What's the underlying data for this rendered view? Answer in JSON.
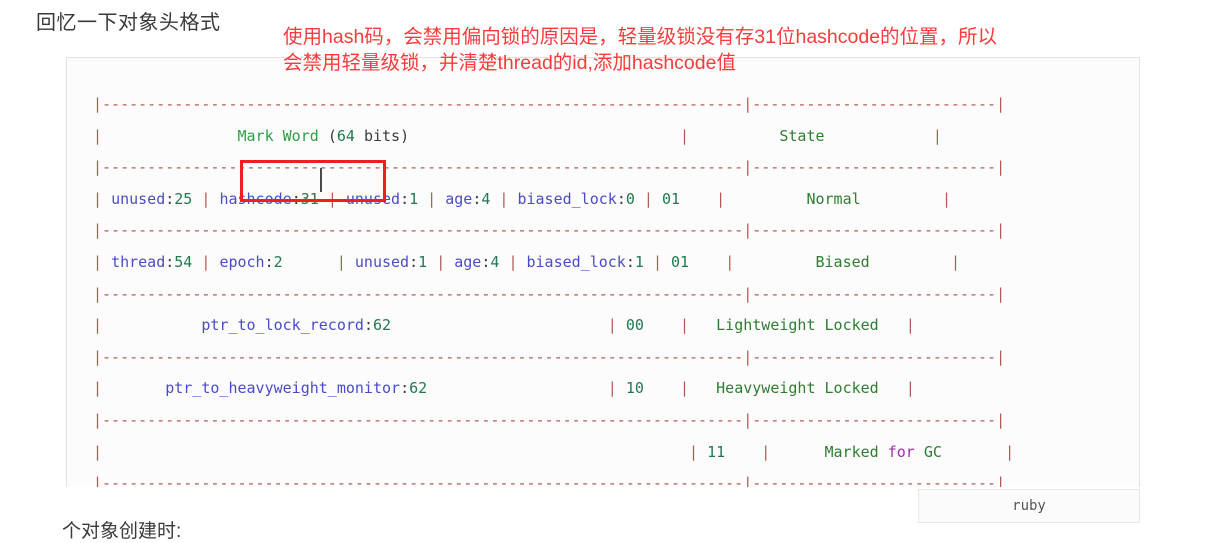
{
  "page": {
    "title": "回忆一下对象头格式",
    "bottom_caption": "个对象创建时:",
    "background_color": "#ffffff"
  },
  "annotation": {
    "color": "#fb3b3b",
    "line1": "使用hash码，会禁用偏向锁的原因是，轻量级锁没有存31位hashcode的位置，所以",
    "line2": "会禁用轻量级锁，并清楚thread的id,添加hashcode值"
  },
  "highlight": {
    "target": "hashcode:31",
    "color": "#ef1f1f"
  },
  "code_card": {
    "language_badge": "ruby",
    "colors": {
      "pipe": "#b05a52",
      "identifier": "#4b4bc8",
      "number": "#1f7a4d",
      "state": "#2f7d32",
      "keyword": "#9b30a8",
      "plain": "#3b3b3b"
    },
    "separator": "|-------------------------------------------------------------------|-----------------------|",
    "lines": {
      "sep_top": "|---------------------------------------------------------------|--------------------------|",
      "header_pipe_l": "|",
      "header_markword": "Mark Word",
      "header_paren_open": "(",
      "header_bits_num": "64",
      "header_bits_word": "bits",
      "header_paren_close": ")",
      "header_pipe_m": "|",
      "header_state": "State",
      "header_pipe_r": "|"
    },
    "table": {
      "header": {
        "left": "Mark Word (64 bits)",
        "right": "State"
      },
      "rows": [
        {
          "cells": [
            "unused:25",
            "hashcode:31",
            "unused:1",
            "age:4",
            "biased_lock:0",
            "01"
          ],
          "state": "Normal"
        },
        {
          "cells": [
            "thread:54",
            "epoch:2",
            "unused:1",
            "age:4",
            "biased_lock:1",
            "01"
          ],
          "state": "Biased"
        },
        {
          "cells": [
            "ptr_to_lock_record:62",
            "00"
          ],
          "state": "Lightweight Locked"
        },
        {
          "cells": [
            "ptr_to_heavyweight_monitor:62",
            "10"
          ],
          "state": "Heavyweight Locked"
        },
        {
          "cells": [
            "11"
          ],
          "state": "Marked for GC"
        }
      ]
    }
  }
}
